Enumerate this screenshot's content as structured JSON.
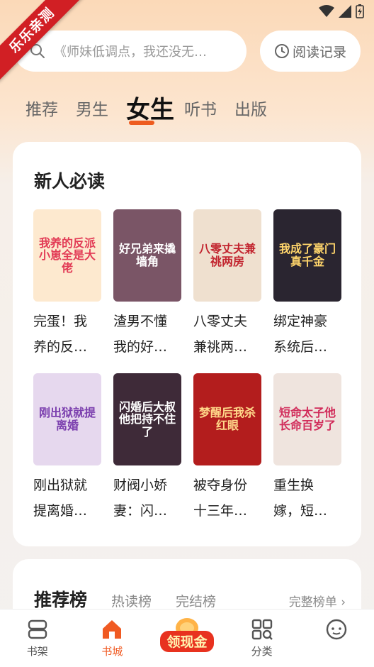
{
  "ribbon": "乐乐亲测",
  "search": {
    "placeholder": "《师妹低调点，我还没无…"
  },
  "history_button": {
    "label": "阅读记录"
  },
  "tabs": [
    {
      "label": "推荐"
    },
    {
      "label": "男生"
    },
    {
      "label": "女生",
      "active": true
    },
    {
      "label": "听书"
    },
    {
      "label": "出版"
    }
  ],
  "section_new": {
    "title": "新人必读",
    "books": [
      {
        "title_line1": "完蛋！我",
        "title_line2": "养的反…",
        "cover_text": "我养的反派小崽全是大佬",
        "cover_bg": "#fde9cf",
        "cover_color": "#e23a55"
      },
      {
        "title_line1": "渣男不懂",
        "title_line2": "我的好…",
        "cover_text": "好兄弟来撬墙角",
        "cover_bg": "#7a5566",
        "cover_color": "#ffffff"
      },
      {
        "title_line1": "八零丈夫",
        "title_line2": "兼祧两…",
        "cover_text": "八零丈夫兼祧两房",
        "cover_bg": "#efe0cf",
        "cover_color": "#c2252f"
      },
      {
        "title_line1": "绑定神豪",
        "title_line2": "系统后…",
        "cover_text": "我成了豪门真千金",
        "cover_bg": "#2a2530",
        "cover_color": "#ffd56b"
      },
      {
        "title_line1": "刚出狱就",
        "title_line2": "提离婚…",
        "cover_text": "刚出狱就提离婚",
        "cover_bg": "#e6d8ee",
        "cover_color": "#7b3fae"
      },
      {
        "title_line1": "财阀小娇",
        "title_line2": "妻：闪…",
        "cover_text": "闪婚后大叔他把持不住了",
        "cover_bg": "#3e2a38",
        "cover_color": "#ffffff"
      },
      {
        "title_line1": "被夺身份",
        "title_line2": "十三年…",
        "cover_text": "梦醒后我杀红眼",
        "cover_bg": "#b31d1d",
        "cover_color": "#ffd88a"
      },
      {
        "title_line1": "重生换",
        "title_line2": "嫁，短…",
        "cover_text": "短命太子他长命百岁了",
        "cover_bg": "#efe4de",
        "cover_color": "#d12c5a"
      }
    ]
  },
  "section_rank": {
    "title": "推荐榜",
    "tabs": [
      "热读榜",
      "完结榜"
    ],
    "more": "完整榜单"
  },
  "bottom_nav": [
    {
      "label": "书架",
      "icon": "bookshelf-icon"
    },
    {
      "label": "书城",
      "icon": "home-icon",
      "active": true
    },
    {
      "label": "领现金",
      "icon": "cash-icon"
    },
    {
      "label": "分类",
      "icon": "category-icon"
    },
    {
      "label": "",
      "icon": "profile-icon"
    }
  ],
  "colors": {
    "accent": "#f05a22",
    "ribbon": "#d11f24"
  }
}
